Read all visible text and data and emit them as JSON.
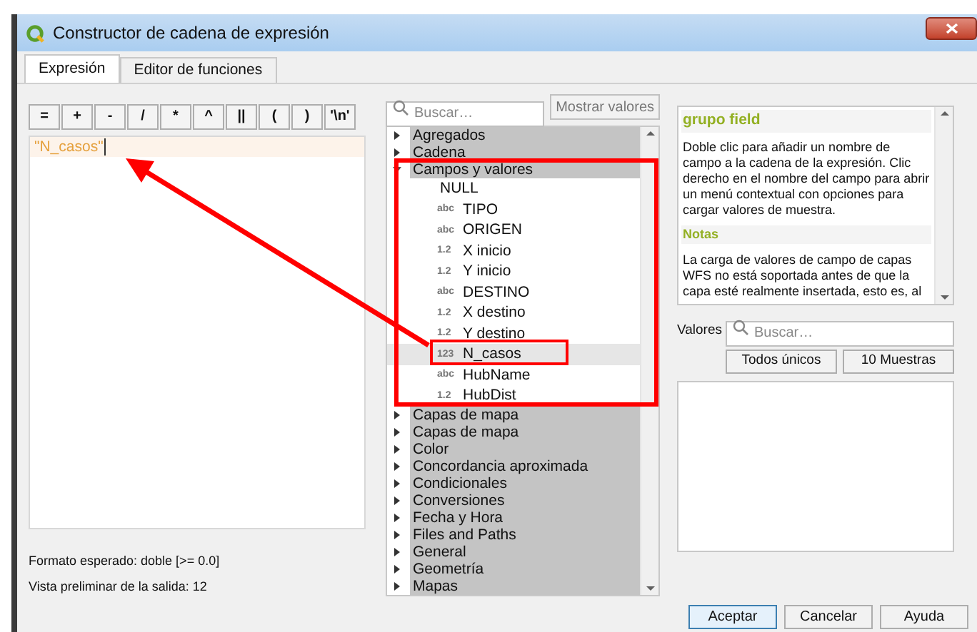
{
  "window": {
    "title": "Constructor de cadena de expresión"
  },
  "tabs": [
    {
      "label": "Expresión",
      "selected": true
    },
    {
      "label": "Editor de funciones",
      "selected": false
    }
  ],
  "operators": [
    "=",
    "+",
    "-",
    "/",
    "*",
    "^",
    "||",
    "(",
    ")",
    "'\\n'"
  ],
  "expression": {
    "value": "\"N_casos\""
  },
  "expected_format": "Formato esperado: doble [>= 0.0]",
  "preview": "Vista preliminar de la salida: 12",
  "search": {
    "placeholder": "Buscar…"
  },
  "show_values_button": "Mostrar valores",
  "tree": [
    {
      "label": "Agregados",
      "expanded": false
    },
    {
      "label": "Cadena",
      "expanded": false
    },
    {
      "label": "Campos y valores",
      "expanded": true,
      "children": [
        {
          "label": "NULL",
          "selected": false
        },
        {
          "type_label": "abc",
          "label": "TIPO",
          "selected": false
        },
        {
          "type_label": "abc",
          "label": "ORIGEN",
          "selected": false
        },
        {
          "type_label": "1.2",
          "label": "X inicio",
          "selected": false
        },
        {
          "type_label": "1.2",
          "label": "Y inicio",
          "selected": false
        },
        {
          "type_label": "abc",
          "label": "DESTINO",
          "selected": false
        },
        {
          "type_label": "1.2",
          "label": "X destino",
          "selected": false
        },
        {
          "type_label": "1.2",
          "label": "Y destino",
          "selected": false
        },
        {
          "type_label": "123",
          "label": "N_casos",
          "selected": true
        },
        {
          "type_label": "abc",
          "label": "HubName",
          "selected": false
        },
        {
          "type_label": "1.2",
          "label": "HubDist",
          "selected": false
        }
      ]
    },
    {
      "label": "Capas de mapa",
      "expanded": false
    },
    {
      "label": "Capas de mapa",
      "expanded": false
    },
    {
      "label": "Color",
      "expanded": false
    },
    {
      "label": "Concordancia aproximada",
      "expanded": false
    },
    {
      "label": "Condicionales",
      "expanded": false
    },
    {
      "label": "Conversiones",
      "expanded": false
    },
    {
      "label": "Fecha y Hora",
      "expanded": false
    },
    {
      "label": "Files and Paths",
      "expanded": false
    },
    {
      "label": "General",
      "expanded": false
    },
    {
      "label": "Geometría",
      "expanded": false
    },
    {
      "label": "Mapas",
      "expanded": false
    }
  ],
  "help": {
    "title": "grupo field",
    "body": "Doble clic para añadir un nombre de campo a la cadena de la expresión. Clic derecho en el nombre del campo para abrir un menú contextual con opciones para cargar valores de muestra.",
    "notes_title": "Notas",
    "notes": "La carga de valores de campo de capas WFS no está soportada antes de que la capa esté realmente insertada, esto es, al"
  },
  "values": {
    "label": "Valores",
    "search": {
      "placeholder": "Buscar…"
    },
    "buttons": [
      "Todos únicos",
      "10 Muestras"
    ]
  },
  "buttons": [
    "Aceptar",
    "Cancelar",
    "Ayuda"
  ]
}
